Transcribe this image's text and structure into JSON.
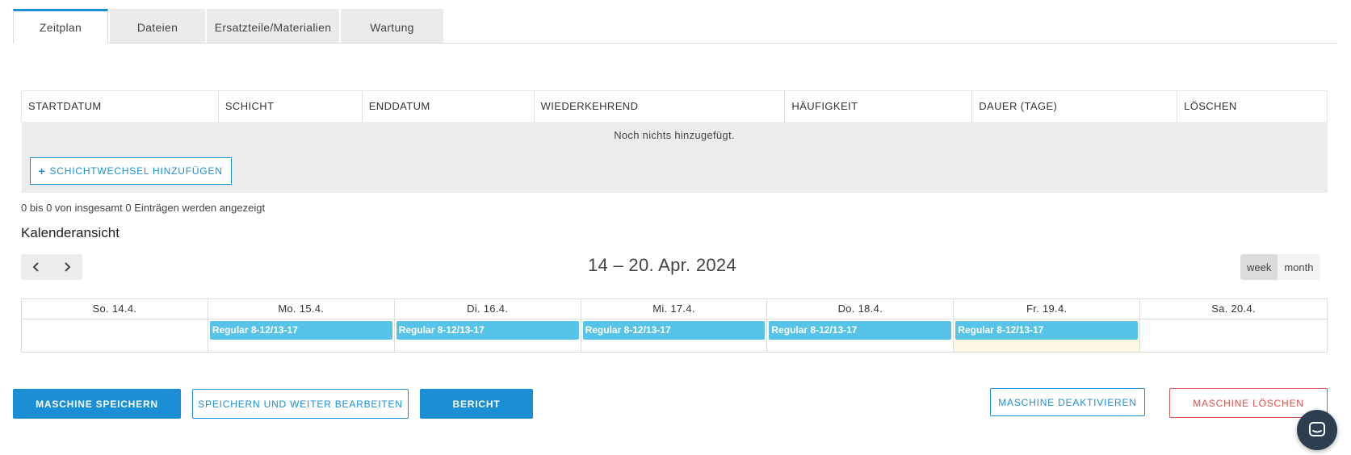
{
  "tabs": [
    {
      "label": "Zeitplan",
      "active": true
    },
    {
      "label": "Dateien",
      "active": false
    },
    {
      "label": "Ersatzteile/Materialien",
      "active": false
    },
    {
      "label": "Wartung",
      "active": false
    }
  ],
  "shift_table": {
    "columns": [
      "STARTDATUM",
      "SCHICHT",
      "ENDDATUM",
      "WIEDERKEHREND",
      "HÄUFIGKEIT",
      "DAUER (TAGE)",
      "LÖSCHEN"
    ],
    "empty_message": "Noch nichts hinzugefügt.",
    "add_button_label": "SCHICHTWECHSEL HINZUFÜGEN",
    "entries_info": "0 bis 0 von insgesamt 0 Einträgen werden angezeigt"
  },
  "calendar": {
    "section_title": "Kalenderansicht",
    "title": "14 – 20. Apr. 2024",
    "views": [
      {
        "label": "week",
        "active": true
      },
      {
        "label": "month",
        "active": false
      }
    ],
    "days": [
      {
        "label": "So. 14.4.",
        "event": "",
        "today": false
      },
      {
        "label": "Mo. 15.4.",
        "event": "Regular 8-12/13-17",
        "today": false
      },
      {
        "label": "Di. 16.4.",
        "event": "Regular 8-12/13-17",
        "today": false
      },
      {
        "label": "Mi. 17.4.",
        "event": "Regular 8-12/13-17",
        "today": false
      },
      {
        "label": "Do. 18.4.",
        "event": "Regular 8-12/13-17",
        "today": false
      },
      {
        "label": "Fr. 19.4.",
        "event": "Regular 8-12/13-17",
        "today": true
      },
      {
        "label": "Sa. 20.4.",
        "event": "",
        "today": false
      }
    ],
    "event_color": "#57c3e8",
    "today_color": "#fcf8e3"
  },
  "actions": {
    "save_machine": "MASCHINE SPEICHERN",
    "save_continue": "SPEICHERN UND WEITER BEARBEITEN",
    "report": "BERICHT",
    "deactivate_machine": "MASCHINE DEAKTIVIEREN",
    "delete_machine": "MASCHINE LÖSCHEN"
  },
  "colors": {
    "primary": "#1b8fd6",
    "danger": "#d9534f",
    "chat_bubble": "#2c3e50"
  },
  "icons": {
    "prev": "chevron-left-icon",
    "next": "chevron-right-icon",
    "add": "plus-icon",
    "chat": "chat-icon"
  }
}
